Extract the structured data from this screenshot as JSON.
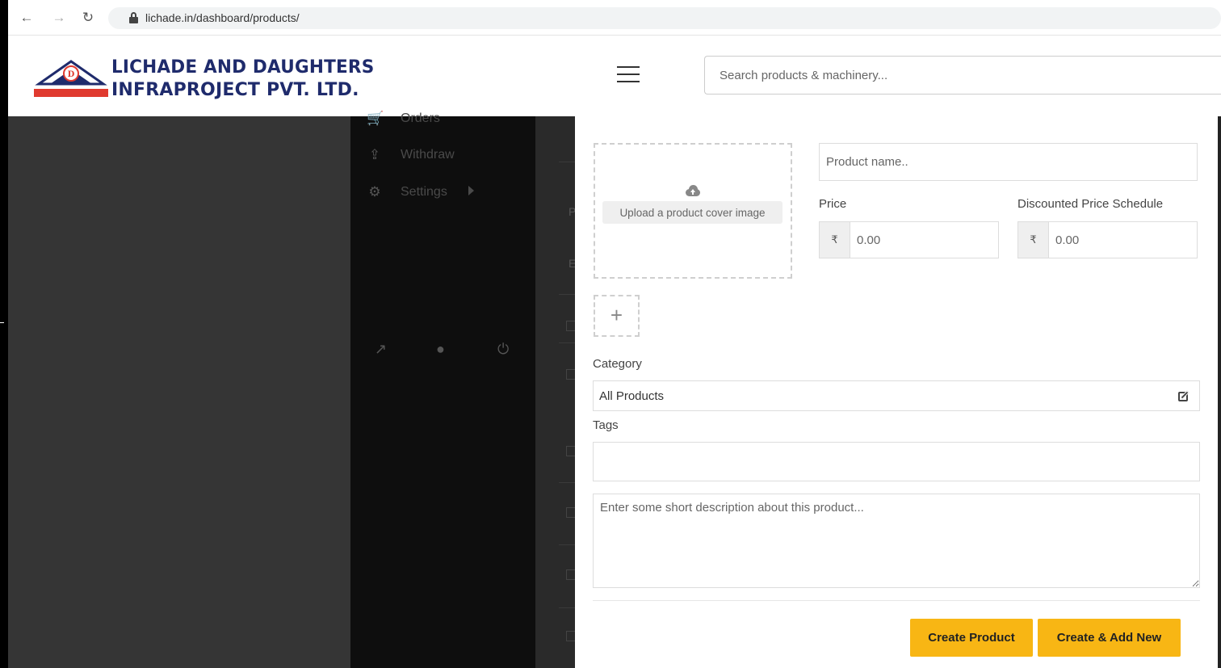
{
  "browser": {
    "url": "lichade.in/dashboard/products/"
  },
  "header": {
    "company_line1": "LICHADE AND DAUGHTERS",
    "company_line2": "INFRAPROJECT PVT. LTD.",
    "search_placeholder": "Search products & machinery..."
  },
  "sidebar": {
    "items": [
      {
        "label": "Orders",
        "icon": "cart-icon"
      },
      {
        "label": "Withdraw",
        "icon": "upload-icon"
      },
      {
        "label": "Settings",
        "icon": "gear-icon"
      }
    ],
    "footer_icons": [
      "external-link-icon",
      "user-icon",
      "power-icon"
    ]
  },
  "background_table": {
    "letters": [
      "P",
      "E"
    ]
  },
  "product_form": {
    "upload_label": "Upload a product cover image",
    "product_name_placeholder": "Product name..",
    "price_label": "Price",
    "discount_label": "Discounted Price Schedule",
    "currency_symbol": "₹",
    "price_placeholder": "0.00",
    "discount_placeholder": "0.00",
    "category_label": "Category",
    "category_value": "All Products",
    "tags_label": "Tags",
    "description_placeholder": "Enter some short description about this product...",
    "create_button": "Create Product",
    "create_add_button": "Create & Add New"
  },
  "colors": {
    "brand_navy": "#1f2b6c",
    "brand_red": "#e03a2f",
    "button_yellow": "#f8b614"
  }
}
